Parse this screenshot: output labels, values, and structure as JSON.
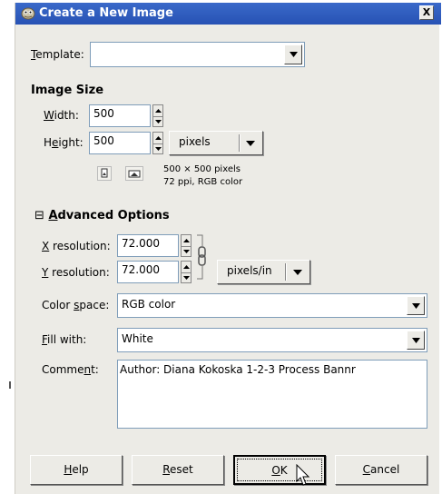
{
  "window": {
    "title": "Create a New Image",
    "close_label": "X"
  },
  "template": {
    "label_u": "T",
    "label_rest": "emplate:",
    "value": ""
  },
  "image_size": {
    "section_title": "Image Size",
    "width_label_u": "W",
    "width_label_rest": "idth:",
    "width_value": "500",
    "height_label_pre": "H",
    "height_label_u": "e",
    "height_label_rest": "ight:",
    "height_value": "500",
    "unit": "pixels",
    "info_line1": "500 × 500 pixels",
    "info_line2": "72 ppi, RGB color"
  },
  "advanced": {
    "toggle": "⊟",
    "title_u": "A",
    "title_rest": "dvanced Options",
    "xres_label_u": "X",
    "xres_label_rest": " resolution:",
    "xres_value": "72.000",
    "yres_label_u": "Y",
    "yres_label_rest": " resolution:",
    "yres_value": "72.000",
    "res_unit": "pixels/in",
    "colorspace_label_pre": "Color ",
    "colorspace_label_u": "s",
    "colorspace_label_rest": "pace:",
    "colorspace_value": "RGB color",
    "fill_label_u": "F",
    "fill_label_rest": "ill with:",
    "fill_value": "White",
    "comment_label_pre": "Comme",
    "comment_label_u": "n",
    "comment_label_rest": "t:",
    "comment_value": "Author:  Diana Kokoska  1-2-3 Process Bannr"
  },
  "buttons": {
    "help_u": "H",
    "help_rest": "elp",
    "reset_u": "R",
    "reset_rest": "eset",
    "ok_u": "O",
    "ok_rest": "K",
    "cancel_u": "C",
    "cancel_rest": "ancel"
  },
  "colors": {
    "titlebar": "#2a56b8",
    "dialog_bg": "#ecebe6",
    "field_border": "#7f9db9"
  },
  "icons": [
    "gimp-logo-icon",
    "close-icon",
    "portrait-icon",
    "landscape-icon",
    "chain-link-icon",
    "dropdown-arrow-icon",
    "spin-up-icon",
    "spin-down-icon",
    "mouse-cursor-icon"
  ]
}
